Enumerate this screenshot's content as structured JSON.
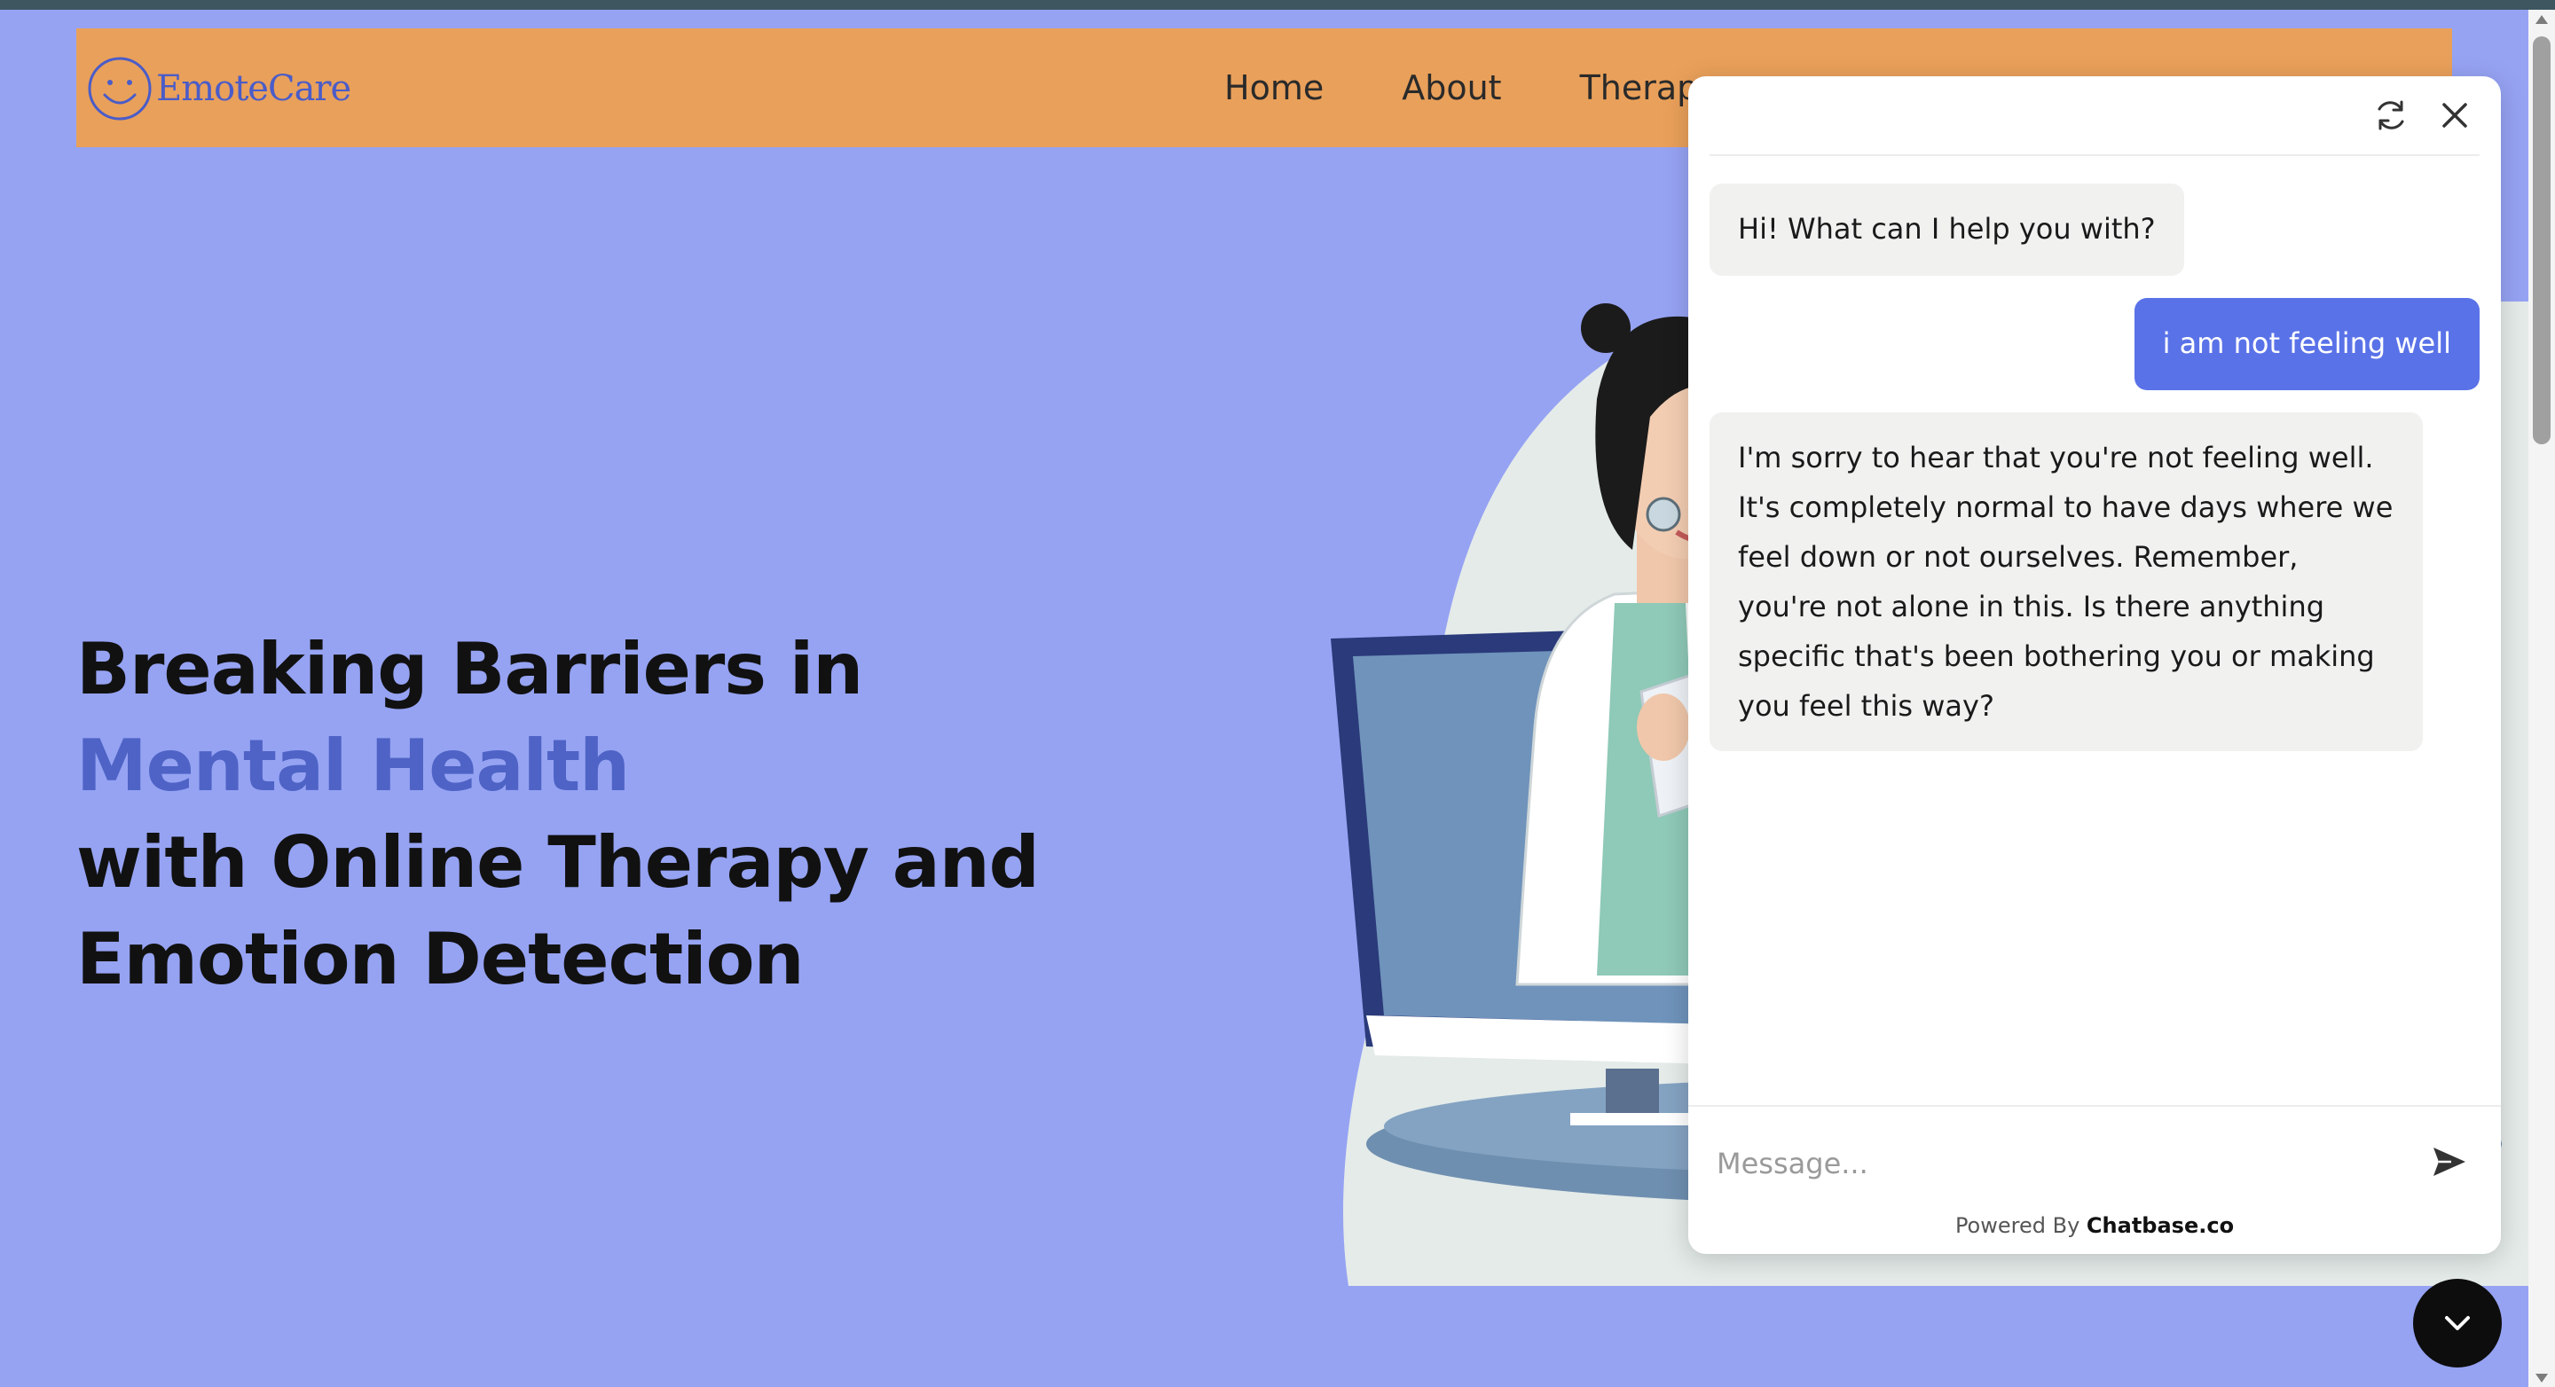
{
  "header": {
    "brand": "EmoteCare",
    "nav": [
      {
        "label": "Home"
      },
      {
        "label": "About"
      },
      {
        "label": "Therapy"
      }
    ]
  },
  "hero": {
    "line1": "Breaking Barriers in",
    "line2": "Mental Health",
    "line3": "with Online Therapy and Emotion Detection"
  },
  "chat": {
    "messages": [
      {
        "role": "bot",
        "text": "Hi! What can I help you with?"
      },
      {
        "role": "user",
        "text": "i am not feeling well"
      },
      {
        "role": "bot",
        "text": "I'm sorry to hear that you're not feeling well. It's completely normal to have days where we feel down or not ourselves. Remember, you're not alone in this. Is there anything specific that's been bothering you or making you feel this way?"
      }
    ],
    "input_placeholder": "Message...",
    "powered_prefix": "Powered By",
    "powered_brand": "Chatbase.co"
  },
  "colors": {
    "background": "#96a3f3",
    "header": "#e9a05a",
    "accent": "#4e63c5",
    "user_bubble": "#5a72e8",
    "bot_bubble": "#f1f1f0"
  },
  "icons": [
    "smiley-logo-icon",
    "refresh-icon",
    "close-icon",
    "send-icon",
    "chevron-down-icon"
  ]
}
